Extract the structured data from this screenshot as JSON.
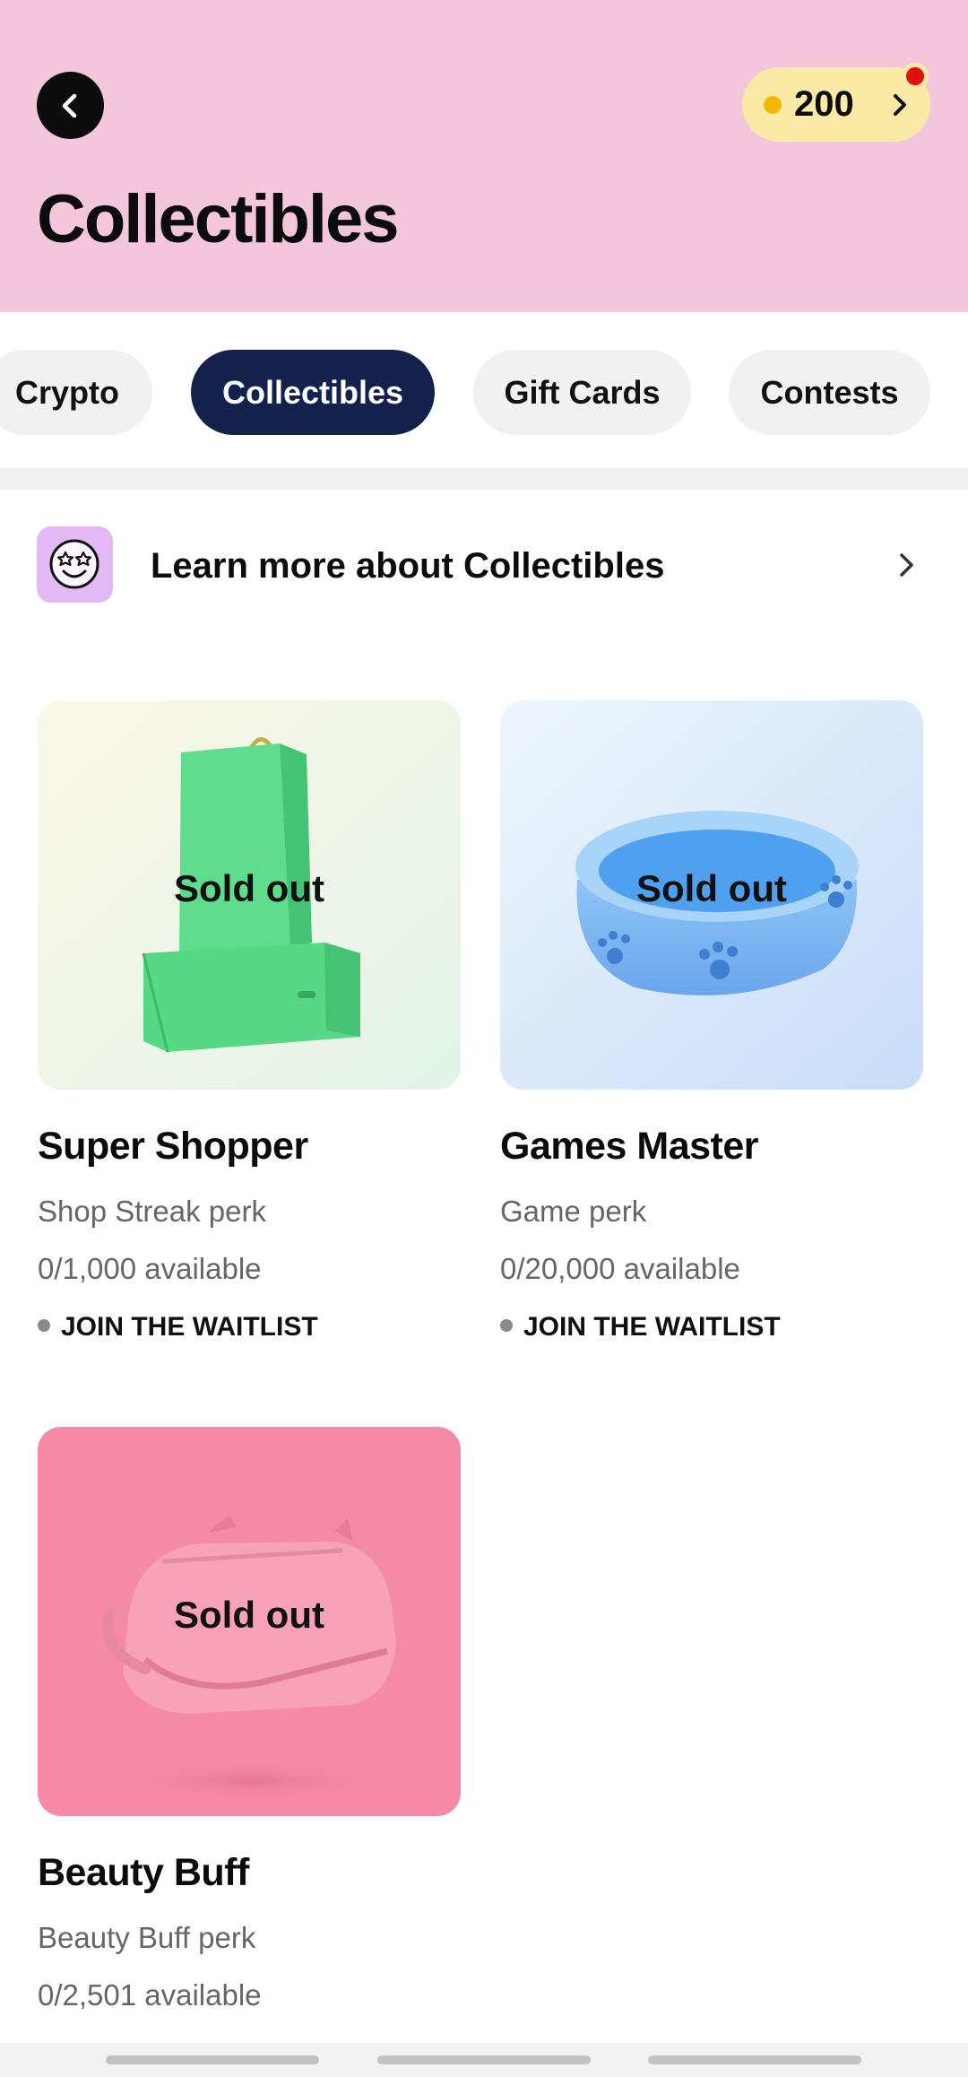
{
  "header": {
    "title": "Collectibles",
    "back_icon": "chevron-left-icon",
    "points": "200",
    "points_chevron_icon": "chevron-right-icon",
    "coin_color": "#f5b800",
    "background_color": "#f3c6dc"
  },
  "tabs": [
    {
      "label": "Crypto",
      "active": false
    },
    {
      "label": "Collectibles",
      "active": true
    },
    {
      "label": "Gift Cards",
      "active": false
    },
    {
      "label": "Contests",
      "active": false
    }
  ],
  "learn_more": {
    "label": "Learn more about Collectibles",
    "icon": "star-eyes-face-icon",
    "chevron_icon": "chevron-right-icon"
  },
  "collectibles": [
    {
      "title": "Super Shopper",
      "perk": "Shop Streak perk",
      "availability": "0/1,000 available",
      "status": "Sold out",
      "action": "JOIN THE WAITLIST",
      "image": "shopping-bag-and-box"
    },
    {
      "title": "Games Master",
      "perk": "Game perk",
      "availability": "0/20,000 available",
      "status": "Sold out",
      "action": "JOIN THE WAITLIST",
      "image": "pet-bowl-with-paw-prints"
    },
    {
      "title": "Beauty Buff",
      "perk": "Beauty Buff perk",
      "availability": "0/2,501 available",
      "status": "Sold out",
      "image": "cosmetic-bag"
    }
  ]
}
